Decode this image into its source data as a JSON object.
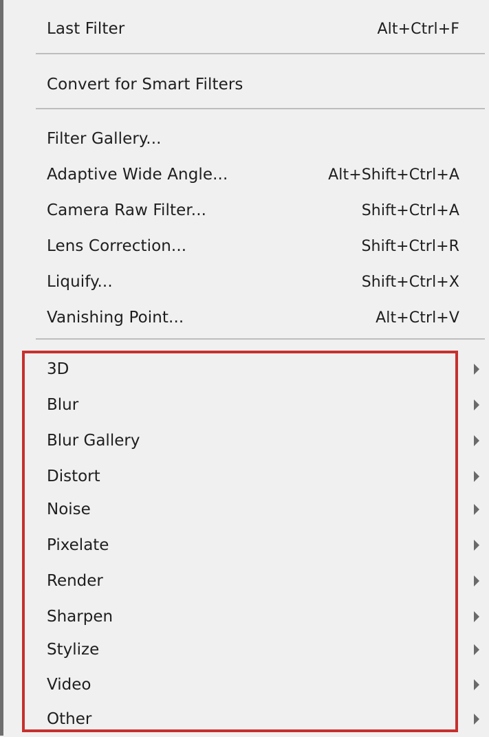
{
  "menu": {
    "top_items": [
      {
        "label": "Last Filter",
        "shortcut": "Alt+Ctrl+F"
      },
      {
        "label": "Convert for Smart Filters",
        "shortcut": ""
      }
    ],
    "filter_items": [
      {
        "label": "Filter Gallery...",
        "shortcut": ""
      },
      {
        "label": "Adaptive Wide Angle...",
        "shortcut": "Alt+Shift+Ctrl+A"
      },
      {
        "label": "Camera Raw Filter...",
        "shortcut": "Shift+Ctrl+A"
      },
      {
        "label": "Lens Correction...",
        "shortcut": "Shift+Ctrl+R"
      },
      {
        "label": "Liquify...",
        "shortcut": "Shift+Ctrl+X"
      },
      {
        "label": "Vanishing Point...",
        "shortcut": "Alt+Ctrl+V"
      }
    ],
    "submenus": [
      {
        "label": "3D"
      },
      {
        "label": "Blur"
      },
      {
        "label": "Blur Gallery"
      },
      {
        "label": "Distort"
      },
      {
        "label": "Noise"
      },
      {
        "label": "Pixelate"
      },
      {
        "label": "Render"
      },
      {
        "label": "Sharpen"
      },
      {
        "label": "Stylize"
      },
      {
        "label": "Video"
      },
      {
        "label": "Other"
      }
    ],
    "submenu_arrow_icon": "chevron-right-icon",
    "highlight_color": "#c6302e"
  }
}
